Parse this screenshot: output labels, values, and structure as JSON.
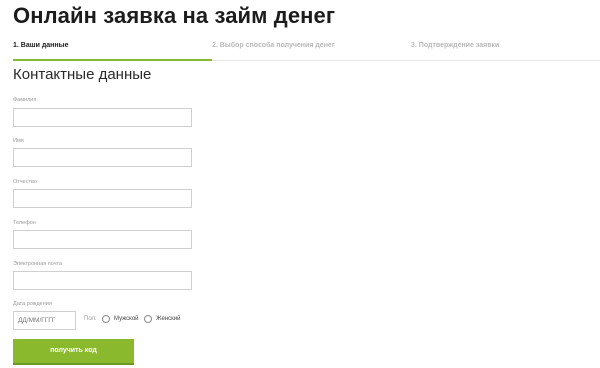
{
  "page": {
    "title": "Онлайн заявка на займ денег"
  },
  "steps": [
    {
      "label": "1. Ваши данные",
      "active": true
    },
    {
      "label": "2. Выбор способа получения денег",
      "active": false
    },
    {
      "label": "3. Подтверждение заявки",
      "active": false
    }
  ],
  "form": {
    "section_title": "Контактные данные",
    "fields": {
      "last_name": {
        "label": "Фамилия",
        "value": ""
      },
      "first_name": {
        "label": "Имя",
        "value": ""
      },
      "middle_name": {
        "label": "Отчество",
        "value": ""
      },
      "phone": {
        "label": "Телефон",
        "value": ""
      },
      "email": {
        "label": "Электронная почта",
        "value": ""
      }
    },
    "birth_date": {
      "label": "Дата рождения",
      "placeholder": "ДД/ММ/ГГГГ",
      "value": ""
    },
    "gender": {
      "label": "Пол:",
      "options": [
        "Мужской",
        "Женский"
      ],
      "selected": null
    },
    "submit_label": "получить код"
  },
  "colors": {
    "accent": "#8ab92d",
    "inactive_text": "#b9b9b9",
    "input_border": "#cfcfcf"
  }
}
